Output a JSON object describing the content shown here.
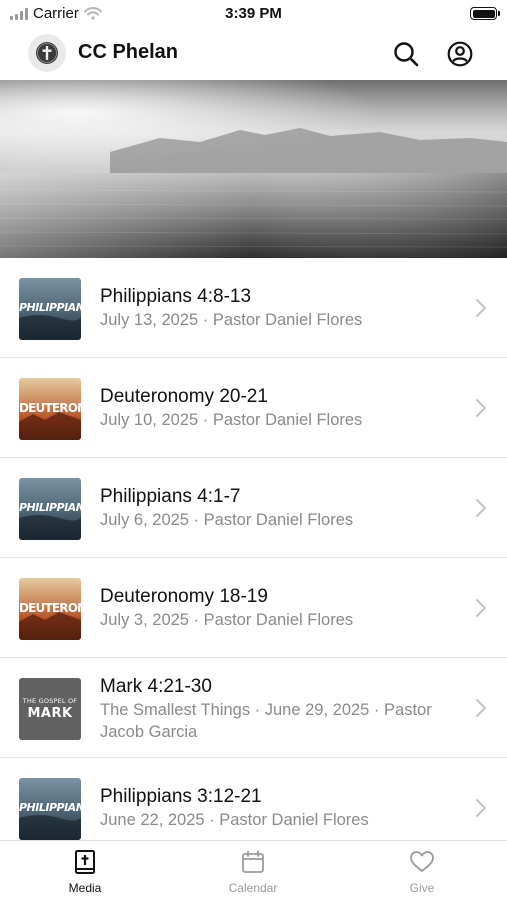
{
  "status_bar": {
    "carrier": "Carrier",
    "time": "3:39 PM"
  },
  "header": {
    "title": "CC Phelan",
    "logo_icon": "church-cross-logo",
    "search_icon": "search-icon",
    "profile_icon": "profile-icon"
  },
  "hero": {
    "description_icon": "ocean-mountains-photo"
  },
  "sermons": [
    {
      "title": "Philippians 4:8-13",
      "subtitle": "July 13, 2025 · Pastor Daniel Flores",
      "series_art": "PHILIPPIANS"
    },
    {
      "title": "Deuteronomy 20-21",
      "subtitle": "July 10, 2025 · Pastor Daniel Flores",
      "series_art": "DEUTERONOMY"
    },
    {
      "title": "Philippians 4:1-7",
      "subtitle": "July 6, 2025 · Pastor Daniel Flores",
      "series_art": "PHILIPPIANS"
    },
    {
      "title": "Deuteronomy 18-19",
      "subtitle": "July 3, 2025 · Pastor Daniel Flores",
      "series_art": "DEUTERONOMY"
    },
    {
      "title": "Mark 4:21-30",
      "subtitle": "The Smallest Things · June 29, 2025 · Pastor Jacob Garcia",
      "series_art": "MARK",
      "series_art_small": "THE GOSPEL OF"
    },
    {
      "title": "Philippians 3:12-21",
      "subtitle": "June 22, 2025 · Pastor Daniel Flores",
      "series_art": "PHILIPPIANS"
    }
  ],
  "tabs": [
    {
      "label": "Media",
      "icon": "bible-icon",
      "active": true
    },
    {
      "label": "Calendar",
      "icon": "calendar-icon",
      "active": false
    },
    {
      "label": "Give",
      "icon": "heart-icon",
      "active": false
    }
  ],
  "colors": {
    "active_tab": "#111111",
    "inactive_tab": "#9a9a9a",
    "subtitle": "#8a8a8a"
  }
}
